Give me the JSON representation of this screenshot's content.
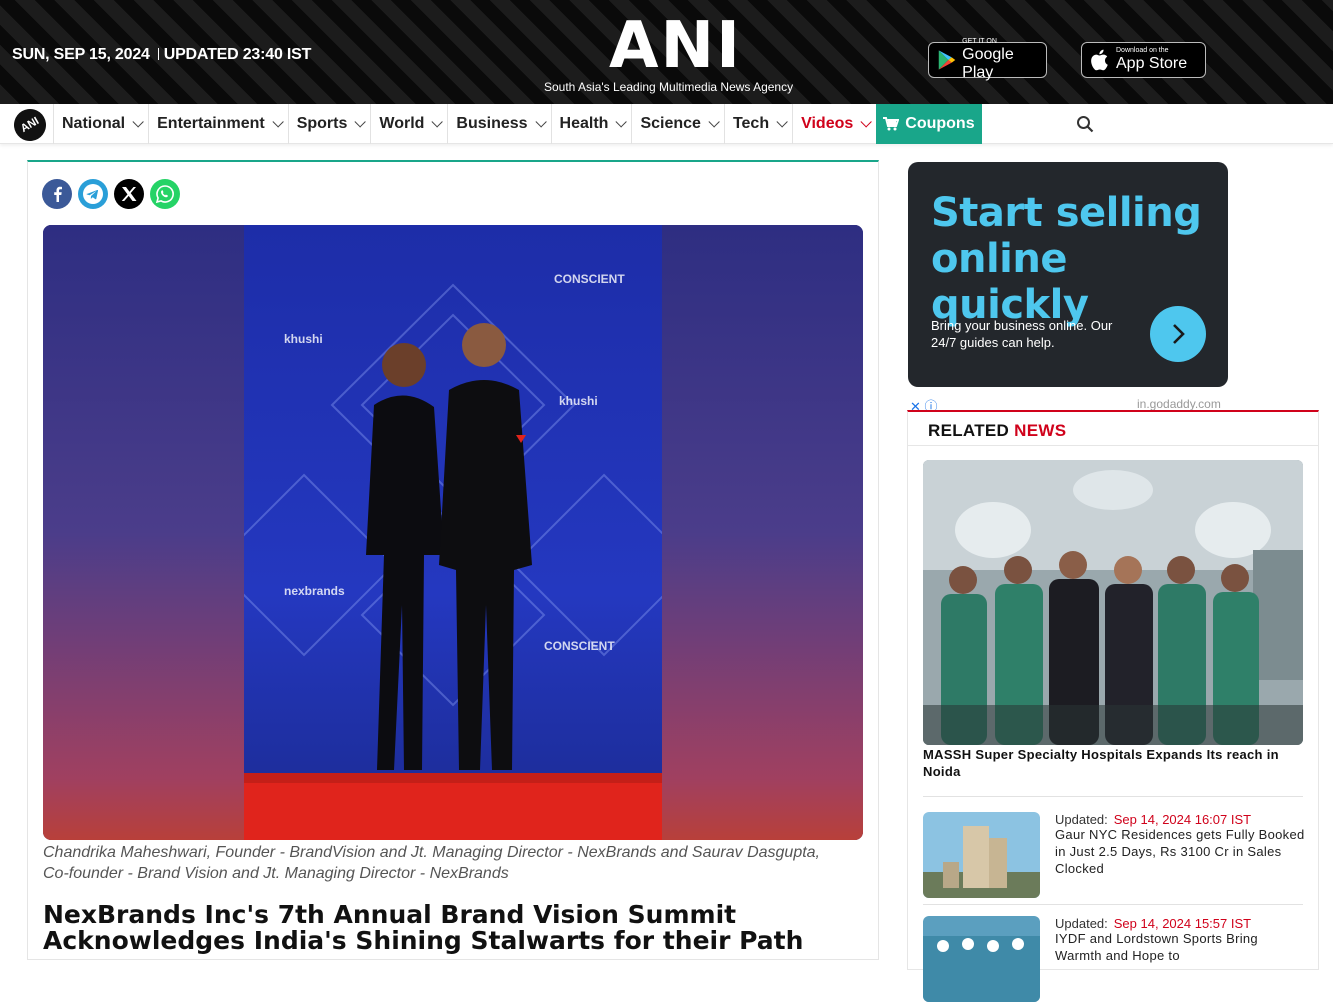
{
  "header": {
    "date": "SUN, SEP 15, 2024",
    "updated": "UPDATED 23:40 IST",
    "logo": "ANI",
    "tagline": "South Asia's Leading Multimedia News Agency",
    "google_play_small": "GET IT ON",
    "google_play_big": "Google Play",
    "app_store_small": "Download on the",
    "app_store_big": "App Store"
  },
  "nav": {
    "logo_text": "ANI",
    "items": [
      {
        "label": "National"
      },
      {
        "label": "Entertainment"
      },
      {
        "label": "Sports"
      },
      {
        "label": "World"
      },
      {
        "label": "Business"
      },
      {
        "label": "Health"
      },
      {
        "label": "Science"
      },
      {
        "label": "Tech"
      },
      {
        "label": "Videos"
      }
    ],
    "coupons": "Coupons",
    "accent_red": "#d0021b",
    "accent_green": "#19a68a"
  },
  "article": {
    "share": [
      "facebook-icon",
      "telegram-icon",
      "x-icon",
      "whatsapp-icon"
    ],
    "caption": "Chandrika Maheshwari, Founder - BrandVision and Jt. Managing Director - NexBrands and Saurav Dasgupta, Co-founder - Brand Vision and Jt. Managing Director - NexBrands",
    "headline": "NexBrands Inc's 7th Annual Brand Vision Summit Acknowledges India's Shining Stalwarts for their Path"
  },
  "ad": {
    "title": "Start selling online quickly",
    "subtitle": "Bring your business online. Our 24/7 guides can help.",
    "domain": "in.godaddy.com",
    "close": "✕ ⓘ"
  },
  "related": {
    "heading_a": "RELATED ",
    "heading_b": "NEWS",
    "lead_title": "MASSH Super Specialty Hospitals Expands Its reach in Noida",
    "items": [
      {
        "updated": "Updated:",
        "date": "Sep 14, 2024 16:07 IST",
        "title": "Gaur NYC Residences gets Fully Booked in Just 2.5 Days, Rs 3100 Cr in Sales Clocked"
      },
      {
        "updated": "Updated:",
        "date": "Sep 14, 2024 15:57 IST",
        "title": "IYDF and Lordstown Sports Bring Warmth and Hope to"
      }
    ]
  }
}
